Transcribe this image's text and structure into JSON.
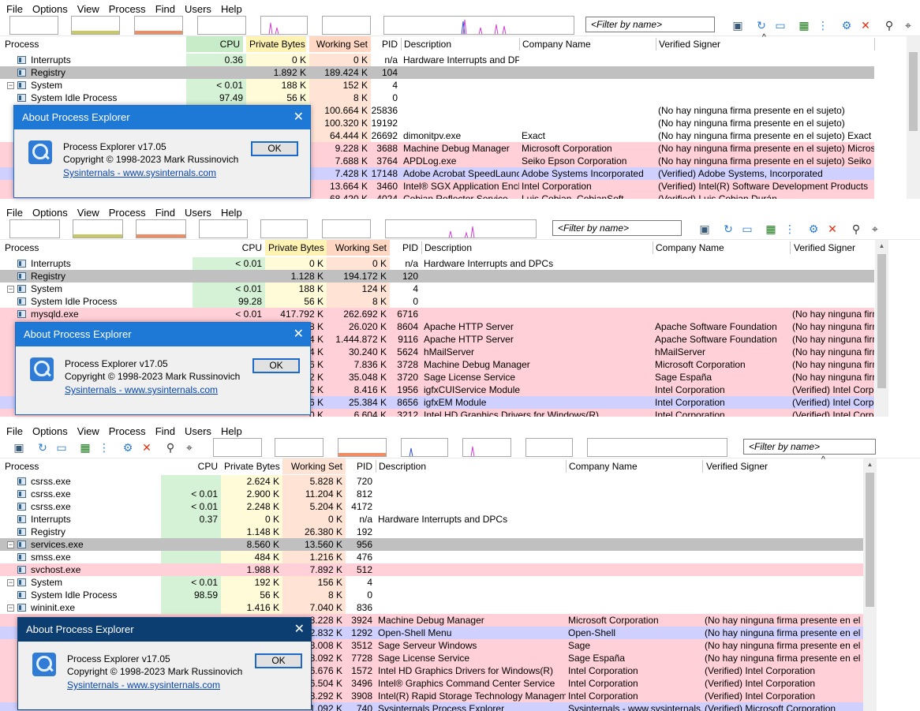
{
  "menu": [
    "File",
    "Options",
    "View",
    "Process",
    "Find",
    "Users",
    "Help"
  ],
  "filter_placeholder": "<Filter by name>",
  "columns": {
    "process": "Process",
    "cpu": "CPU",
    "private": "Private Bytes",
    "working": "Working Set",
    "pid": "PID",
    "desc": "Description",
    "company": "Company Name",
    "signer": "Verified Signer"
  },
  "colors": {
    "pink": "#ffd0d7",
    "purple": "#d0d0ff",
    "gray": "#c0c0c0",
    "cpu_col": "#d6f2d6",
    "priv_col": "#fffbd8",
    "ws_col": "#ffe4d6",
    "cpu_hdr": "#c8ecc8",
    "priv_hdr": "#fff3b4",
    "ws_hdr": "#ffd7c2",
    "dialog_title_1": "#1d78d6",
    "dialog_title_2": "#1d78d6",
    "dialog_title_3": "#0c3e72"
  },
  "dialog": {
    "title": "About Process Explorer",
    "version": "Process Explorer v17.05",
    "copyright": "Copyright © 1998-2023 Mark Russinovich",
    "link": "Sysinternals - www.sysinternals.com",
    "ok": "OK",
    "close_glyph": "✕"
  },
  "panel1": {
    "rows": [
      {
        "name": "Interrupts",
        "cpu": "0.36",
        "priv": "0 K",
        "ws": "0 K",
        "pid": "n/a",
        "desc": "Hardware Interrupts and DPCs",
        "company": "",
        "signer": "",
        "bg": "",
        "tree": ""
      },
      {
        "name": "Registry",
        "cpu": "",
        "priv": "1.892 K",
        "ws": "189.424 K",
        "pid": "104",
        "desc": "",
        "company": "",
        "signer": "",
        "bg": "gray",
        "tree": ""
      },
      {
        "name": "System",
        "cpu": "< 0.01",
        "priv": "188 K",
        "ws": "152 K",
        "pid": "4",
        "desc": "",
        "company": "",
        "signer": "",
        "bg": "",
        "tree": "⊟"
      },
      {
        "name": "System Idle Process",
        "cpu": "97.49",
        "priv": "56 K",
        "ws": "8 K",
        "pid": "0",
        "desc": "",
        "company": "",
        "signer": "",
        "bg": "",
        "tree": ""
      },
      {
        "name": "",
        "cpu": "",
        "priv": "",
        "ws": "100.664 K",
        "pid": "25836",
        "desc": "",
        "company": "",
        "signer": "(No hay ninguna firma presente en el sujeto)",
        "bg": "",
        "tree": ""
      },
      {
        "name": "",
        "cpu": "",
        "priv": "",
        "ws": "100.320 K",
        "pid": "19192",
        "desc": "",
        "company": "",
        "signer": "(No hay ninguna firma presente en el sujeto)",
        "bg": "",
        "tree": ""
      },
      {
        "name": "",
        "cpu": "",
        "priv": "",
        "ws": "64.444 K",
        "pid": "26692",
        "desc": "dimonitpv.exe",
        "company": "Exact",
        "signer": "(No hay ninguna firma presente en el sujeto) Exact",
        "bg": "",
        "tree": ""
      },
      {
        "name": "",
        "cpu": "",
        "priv": "",
        "ws": "9.228 K",
        "pid": "3688",
        "desc": "Machine Debug Manager",
        "company": "Microsoft Corporation",
        "signer": "(No hay ninguna firma presente en el sujeto) Microsoft C...",
        "bg": "pink",
        "tree": ""
      },
      {
        "name": "",
        "cpu": "",
        "priv": "",
        "ws": "7.688 K",
        "pid": "3764",
        "desc": "APDLog.exe",
        "company": "Seiko Epson Corporation",
        "signer": "(No hay ninguna firma presente en el sujeto) Seiko Epso...",
        "bg": "pink",
        "tree": ""
      },
      {
        "name": "",
        "cpu": "",
        "priv": "",
        "ws": "7.428 K",
        "pid": "17148",
        "desc": "Adobe Acrobat SpeedLaunc...",
        "company": "Adobe Systems Incorporated",
        "signer": "(Verified) Adobe Systems, Incorporated",
        "bg": "purple",
        "tree": ""
      },
      {
        "name": "",
        "cpu": "",
        "priv": "",
        "ws": "13.664 K",
        "pid": "3460",
        "desc": "Intel® SGX Application Encl...",
        "company": "Intel Corporation",
        "signer": "(Verified) Intel(R) Software Development Products",
        "bg": "pink",
        "tree": ""
      },
      {
        "name": "",
        "cpu": "",
        "priv": "",
        "ws": "68.420 K",
        "pid": "4024",
        "desc": "Cobian Reflector Service",
        "company": "Luis Cobian, CobianSoft",
        "signer": "(Verified) Luis Cobian Durán",
        "bg": "pink",
        "tree": ""
      }
    ]
  },
  "panel2": {
    "rows": [
      {
        "name": "Interrupts",
        "cpu": "< 0.01",
        "priv": "0 K",
        "ws": "0 K",
        "pid": "n/a",
        "desc": "Hardware Interrupts and DPCs",
        "company": "",
        "signer": "",
        "bg": "",
        "tree": ""
      },
      {
        "name": "Registry",
        "cpu": "",
        "priv": "1.128 K",
        "ws": "194.172 K",
        "pid": "120",
        "desc": "",
        "company": "",
        "signer": "",
        "bg": "gray",
        "tree": ""
      },
      {
        "name": "System",
        "cpu": "< 0.01",
        "priv": "188 K",
        "ws": "124 K",
        "pid": "4",
        "desc": "",
        "company": "",
        "signer": "",
        "bg": "",
        "tree": "⊟"
      },
      {
        "name": "System Idle Process",
        "cpu": "99.28",
        "priv": "56 K",
        "ws": "8 K",
        "pid": "0",
        "desc": "",
        "company": "",
        "signer": "",
        "bg": "",
        "tree": ""
      },
      {
        "name": "mysqld.exe",
        "cpu": "< 0.01",
        "priv": "417.792 K",
        "ws": "262.692 K",
        "pid": "6716",
        "desc": "",
        "company": "",
        "signer": "(No hay ninguna firma",
        "bg": "pink",
        "tree": ""
      },
      {
        "name": "",
        "cpu": "",
        "priv": "8 K",
        "ws": "26.020 K",
        "pid": "8604",
        "desc": "Apache HTTP Server",
        "company": "Apache Software Foundation",
        "signer": "(No hay ninguna firma",
        "bg": "pink",
        "tree": ""
      },
      {
        "name": "",
        "cpu": "",
        "priv": "4 K",
        "ws": "1.444.872 K",
        "pid": "9116",
        "desc": "Apache HTTP Server",
        "company": "Apache Software Foundation",
        "signer": "(No hay ninguna firma",
        "bg": "pink",
        "tree": ""
      },
      {
        "name": "",
        "cpu": "",
        "priv": "4 K",
        "ws": "30.240 K",
        "pid": "5624",
        "desc": "hMailServer",
        "company": "hMailServer",
        "signer": "(No hay ninguna firma",
        "bg": "pink",
        "tree": ""
      },
      {
        "name": "",
        "cpu": "",
        "priv": "6 K",
        "ws": "7.836 K",
        "pid": "3728",
        "desc": "Machine Debug Manager",
        "company": "Microsoft Corporation",
        "signer": "(No hay ninguna firma",
        "bg": "pink",
        "tree": ""
      },
      {
        "name": "",
        "cpu": "",
        "priv": "2 K",
        "ws": "35.048 K",
        "pid": "3720",
        "desc": "Sage License Service",
        "company": "Sage España",
        "signer": "(No hay ninguna firma",
        "bg": "pink",
        "tree": ""
      },
      {
        "name": "",
        "cpu": "",
        "priv": "2 K",
        "ws": "8.416 K",
        "pid": "1956",
        "desc": "igfxCUIService Module",
        "company": "Intel Corporation",
        "signer": "(Verified) Intel Corpora",
        "bg": "pink",
        "tree": ""
      },
      {
        "name": "",
        "cpu": "",
        "priv": "6 K",
        "ws": "25.384 K",
        "pid": "8656",
        "desc": "igfxEM Module",
        "company": "Intel Corporation",
        "signer": "(Verified) Intel Corpora",
        "bg": "purple",
        "tree": ""
      },
      {
        "name": "",
        "cpu": "",
        "priv": "0 K",
        "ws": "6.604 K",
        "pid": "3212",
        "desc": "Intel HD Graphics Drivers for Windows(R)",
        "company": "Intel Corporation",
        "signer": "(Verified) Intel Corpora",
        "bg": "pink",
        "tree": ""
      }
    ]
  },
  "panel3": {
    "rows": [
      {
        "name": "csrss.exe",
        "cpu": "",
        "priv": "2.624 K",
        "ws": "5.828 K",
        "pid": "720",
        "desc": "",
        "company": "",
        "signer": "",
        "bg": "",
        "tree": ""
      },
      {
        "name": "csrss.exe",
        "cpu": "< 0.01",
        "priv": "2.900 K",
        "ws": "11.204 K",
        "pid": "812",
        "desc": "",
        "company": "",
        "signer": "",
        "bg": "",
        "tree": ""
      },
      {
        "name": "csrss.exe",
        "cpu": "< 0.01",
        "priv": "2.248 K",
        "ws": "5.204 K",
        "pid": "4172",
        "desc": "",
        "company": "",
        "signer": "",
        "bg": "",
        "tree": ""
      },
      {
        "name": "Interrupts",
        "cpu": "0.37",
        "priv": "0 K",
        "ws": "0 K",
        "pid": "n/a",
        "desc": "Hardware Interrupts and DPCs",
        "company": "",
        "signer": "",
        "bg": "",
        "tree": ""
      },
      {
        "name": "Registry",
        "cpu": "",
        "priv": "1.148 K",
        "ws": "26.380 K",
        "pid": "192",
        "desc": "",
        "company": "",
        "signer": "",
        "bg": "",
        "tree": ""
      },
      {
        "name": "services.exe",
        "cpu": "",
        "priv": "8.560 K",
        "ws": "13.560 K",
        "pid": "956",
        "desc": "",
        "company": "",
        "signer": "",
        "bg": "gray",
        "tree": "⊟"
      },
      {
        "name": "smss.exe",
        "cpu": "",
        "priv": "484 K",
        "ws": "1.216 K",
        "pid": "476",
        "desc": "",
        "company": "",
        "signer": "",
        "bg": "",
        "tree": ""
      },
      {
        "name": "svchost.exe",
        "cpu": "",
        "priv": "1.988 K",
        "ws": "7.892 K",
        "pid": "512",
        "desc": "",
        "company": "",
        "signer": "",
        "bg": "pink",
        "tree": ""
      },
      {
        "name": "System",
        "cpu": "< 0.01",
        "priv": "192 K",
        "ws": "156 K",
        "pid": "4",
        "desc": "",
        "company": "",
        "signer": "",
        "bg": "",
        "tree": "⊟"
      },
      {
        "name": "System Idle Process",
        "cpu": "98.59",
        "priv": "56 K",
        "ws": "8 K",
        "pid": "0",
        "desc": "",
        "company": "",
        "signer": "",
        "bg": "",
        "tree": ""
      },
      {
        "name": "wininit.exe",
        "cpu": "",
        "priv": "1.416 K",
        "ws": "7.040 K",
        "pid": "836",
        "desc": "",
        "company": "",
        "signer": "",
        "bg": "",
        "tree": "⊟"
      },
      {
        "name": "",
        "cpu": "",
        "priv": "",
        "ws": "8.228 K",
        "pid": "3924",
        "desc": "Machine Debug Manager",
        "company": "Microsoft Corporation",
        "signer": "(No hay ninguna firma presente en el sujeto",
        "bg": "pink",
        "tree": ""
      },
      {
        "name": "",
        "cpu": "",
        "priv": "",
        "ws": "2.832 K",
        "pid": "1292",
        "desc": "Open-Shell Menu",
        "company": "Open-Shell",
        "signer": "(No hay ninguna firma presente en el sujeto",
        "bg": "purple",
        "tree": ""
      },
      {
        "name": "",
        "cpu": "",
        "priv": "",
        "ws": "8.008 K",
        "pid": "3512",
        "desc": "Sage Serveur Windows",
        "company": "Sage",
        "signer": "(No hay ninguna firma presente en el sujeto",
        "bg": "pink",
        "tree": ""
      },
      {
        "name": "",
        "cpu": "",
        "priv": "",
        "ws": "8.092 K",
        "pid": "7728",
        "desc": "Sage License Service",
        "company": "Sage España",
        "signer": "(No hay ninguna firma presente en el sujeto",
        "bg": "pink",
        "tree": ""
      },
      {
        "name": "",
        "cpu": "",
        "priv": "",
        "ws": "6.676 K",
        "pid": "1572",
        "desc": "Intel HD Graphics Drivers for Windows(R)",
        "company": "Intel Corporation",
        "signer": "(Verified) Intel Corporation",
        "bg": "pink",
        "tree": ""
      },
      {
        "name": "",
        "cpu": "",
        "priv": "",
        "ws": "6.504 K",
        "pid": "3496",
        "desc": "Intel® Graphics Command Center Service",
        "company": "Intel Corporation",
        "signer": "(Verified) Intel Corporation",
        "bg": "pink",
        "tree": ""
      },
      {
        "name": "",
        "cpu": "",
        "priv": "",
        "ws": "8.292 K",
        "pid": "3908",
        "desc": "Intel(R) Rapid Storage Technology Managemen...",
        "company": "Intel Corporation",
        "signer": "(Verified) Intel Corporation",
        "bg": "pink",
        "tree": ""
      },
      {
        "name": "",
        "cpu": "",
        "priv": "",
        "ws": "1.092 K",
        "pid": "740",
        "desc": "Sysinternals Process Explorer",
        "company": "Sysinternals - www.sysinternals.com",
        "signer": "(Verified) Microsoft Corporation",
        "bg": "purple",
        "tree": ""
      }
    ]
  }
}
